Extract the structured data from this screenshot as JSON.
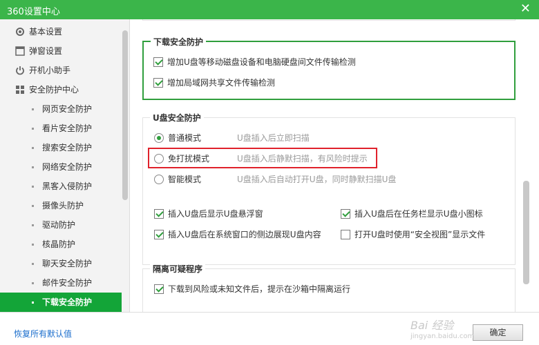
{
  "window": {
    "title": "360设置中心",
    "close_glyph": "✕"
  },
  "sidebar": {
    "items": [
      {
        "label": "基本设置",
        "icon": "gear-icon"
      },
      {
        "label": "弹窗设置",
        "icon": "window-icon"
      },
      {
        "label": "开机小助手",
        "icon": "power-icon"
      },
      {
        "label": "安全防护中心",
        "icon": "shield-grid-icon"
      }
    ],
    "subitems": [
      "网页安全防护",
      "看片安全防护",
      "搜索安全防护",
      "网络安全防护",
      "黑客入侵防护",
      "摄像头防护",
      "驱动防护",
      "核晶防护",
      "聊天安全防护",
      "邮件安全防护",
      "下载安全防护"
    ],
    "active_index": 10
  },
  "download_group": {
    "title": "下载安全防护",
    "options": [
      {
        "label": "增加U盘等移动磁盘设备和电脑硬盘间文件传输检测",
        "checked": true
      },
      {
        "label": "增加局域网共享文件传输检测",
        "checked": true
      }
    ]
  },
  "usb_group": {
    "title": "U盘安全防护",
    "modes": [
      {
        "label": "普通模式",
        "desc": "U盘插入后立即扫描",
        "selected": true
      },
      {
        "label": "免打扰模式",
        "desc": "U盘插入后静默扫描，有风险时提示",
        "selected": false
      },
      {
        "label": "智能模式",
        "desc": "U盘插入后自动打开U盘，同时静默扫描U盘",
        "selected": false
      }
    ],
    "options": [
      {
        "label": "插入U盘后显示U盘悬浮窗",
        "checked": true
      },
      {
        "label": "插入U盘后在任务栏显示U盘小图标",
        "checked": true
      },
      {
        "label": "插入U盘后在系统窗口的侧边展现U盘内容",
        "checked": true
      },
      {
        "label": "打开U盘时使用“安全视图”显示文件",
        "checked": false
      }
    ]
  },
  "isolate_group": {
    "title": "隔离可疑程序",
    "options": [
      {
        "label": "下载到风险或未知文件后，提示在沙箱中隔离运行",
        "checked": true
      }
    ]
  },
  "footer": {
    "restore_label": "恢复所有默认值",
    "ok_label": "确定"
  },
  "watermark": {
    "main": "Bai 经验",
    "sub": "jingyan.baidu.com"
  },
  "colors": {
    "accent": "#3bb54a",
    "active": "#13a538",
    "highlight_box": "#e0212b",
    "link": "#1a6dcc"
  }
}
